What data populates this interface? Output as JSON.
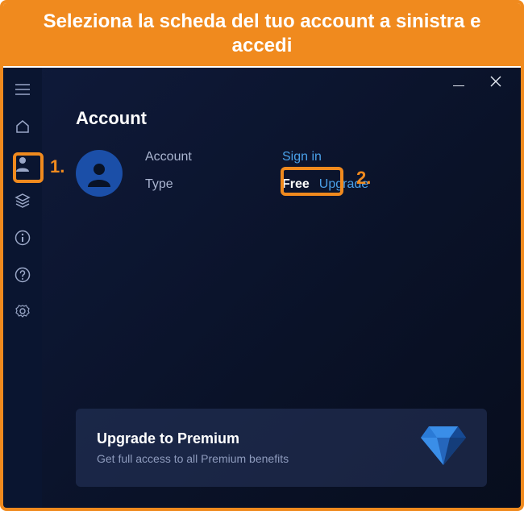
{
  "instruction": "Seleziona la scheda del tuo account a sinistra e accedi",
  "annotations": {
    "step1": "1.",
    "step2": "2."
  },
  "sidebar": {
    "icons": {
      "menu": "menu-icon",
      "home": "home-icon",
      "account": "person-icon",
      "layers": "layers-icon",
      "info": "info-icon",
      "help": "help-icon",
      "settings": "gear-icon"
    }
  },
  "page": {
    "title": "Account",
    "account_label": "Account",
    "type_label": "Type",
    "signin": "Sign in",
    "type_value": "Free",
    "upgrade_link": "Upgrade"
  },
  "promo": {
    "title": "Upgrade to Premium",
    "subtitle": "Get full access to all Premium benefits"
  },
  "colors": {
    "accent_orange": "#f08a1e",
    "link_blue": "#4aa0e8",
    "bg_dark": "#0a1228"
  }
}
